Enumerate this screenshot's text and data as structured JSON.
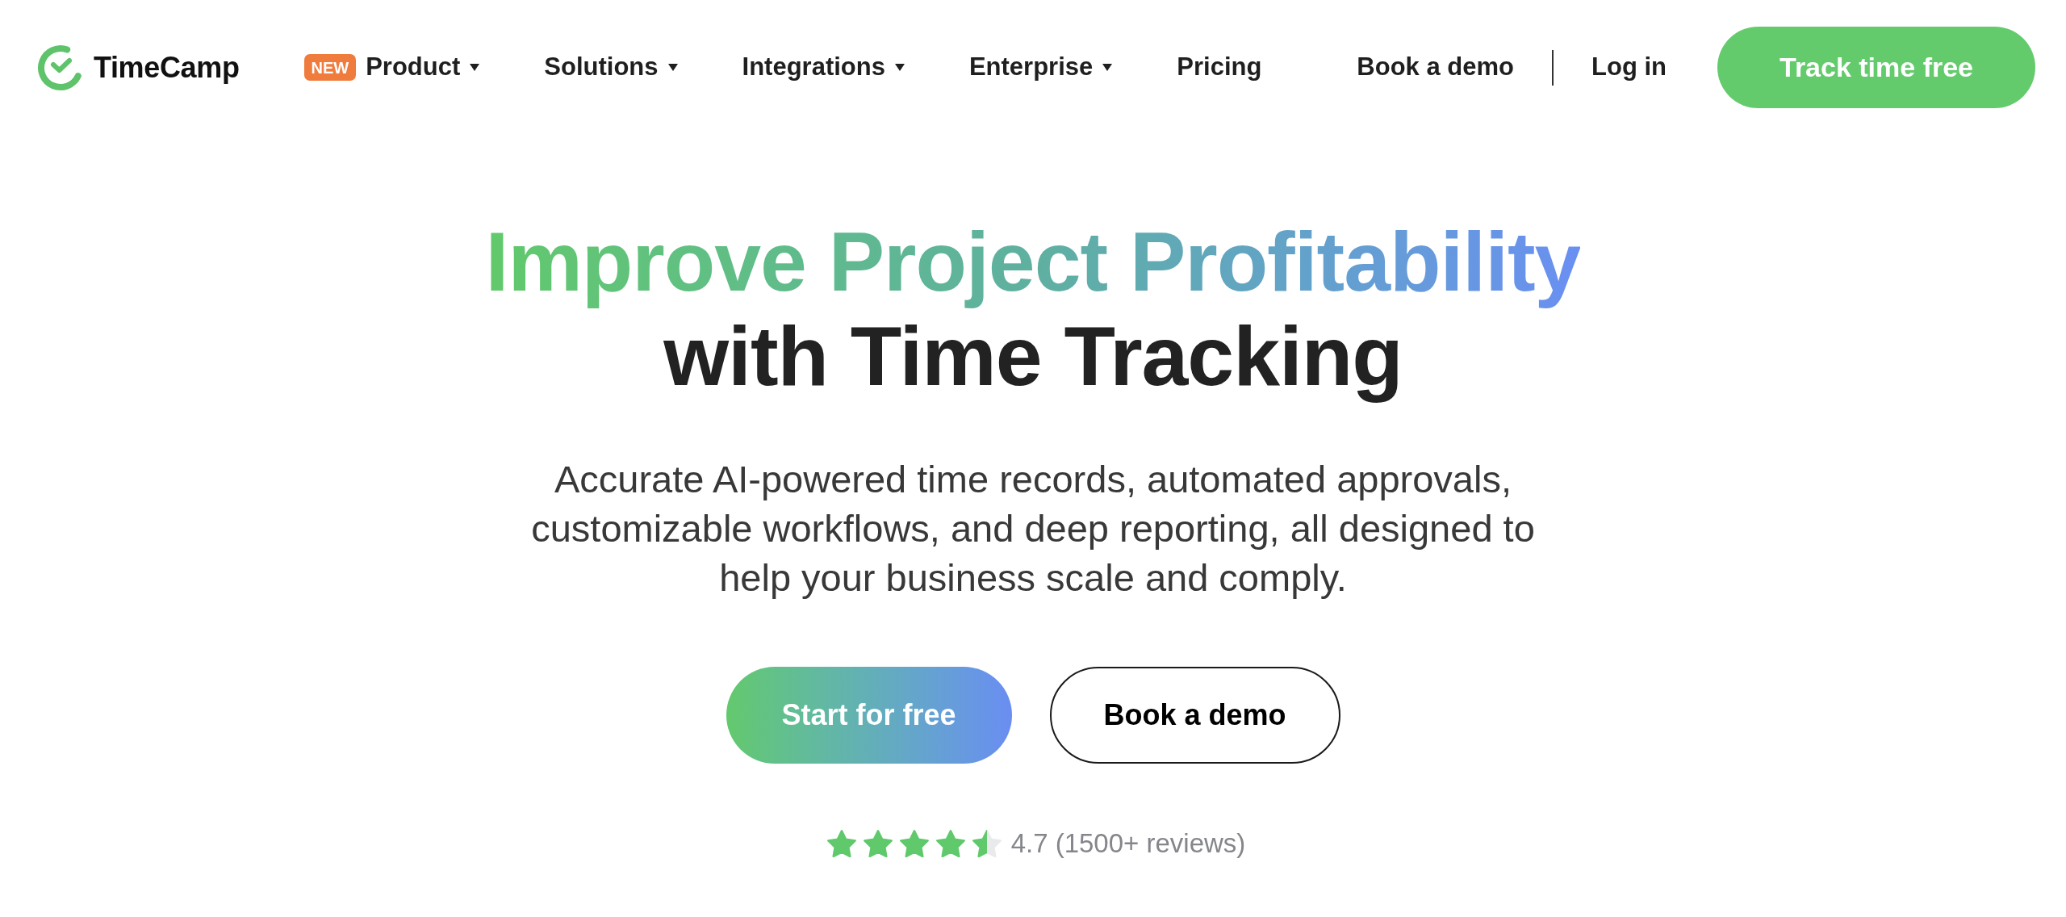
{
  "header": {
    "logo": {
      "text": "TimeCamp"
    },
    "nav": [
      {
        "label": "Product",
        "badge": "NEW",
        "has_menu": true
      },
      {
        "label": "Solutions",
        "has_menu": true
      },
      {
        "label": "Integrations",
        "has_menu": true
      },
      {
        "label": "Enterprise",
        "has_menu": true
      },
      {
        "label": "Pricing",
        "has_menu": false
      }
    ],
    "actions": [
      {
        "kind": "link",
        "label": "Book a demo"
      },
      {
        "kind": "link",
        "label": "Log in"
      },
      {
        "kind": "button",
        "label": "Track time free"
      }
    ]
  },
  "hero": {
    "title": {
      "highlight": "Improve Project Profitability",
      "rest": "with Time Tracking"
    },
    "description": "Accurate AI-powered time records, automated approvals, customizable workflows, and deep reporting, all designed to help your business scale and comply.",
    "buttons": [
      {
        "kind": "primary",
        "label": "Start for free"
      },
      {
        "kind": "outline",
        "label": "Book a demo"
      }
    ],
    "rating": {
      "stars": 4.5,
      "text": "4.7 (1500+ reviews)"
    }
  }
}
